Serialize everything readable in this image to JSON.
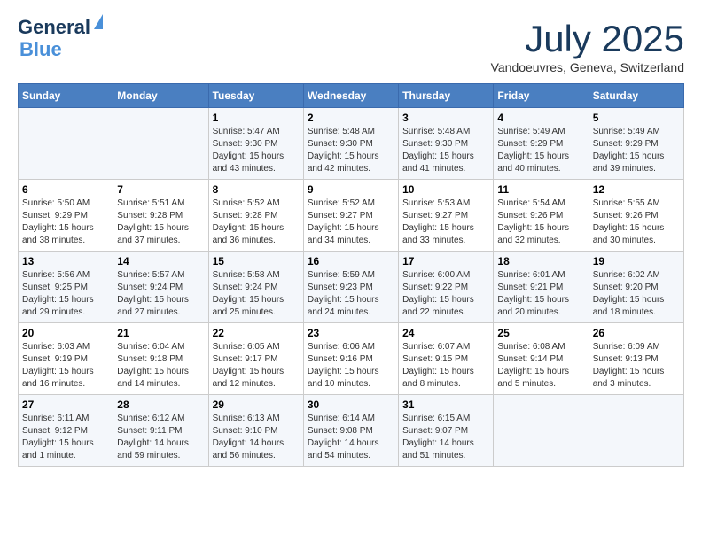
{
  "header": {
    "logo_line1": "General",
    "logo_line2": "Blue",
    "month": "July 2025",
    "location": "Vandoeuvres, Geneva, Switzerland"
  },
  "days_of_week": [
    "Sunday",
    "Monday",
    "Tuesday",
    "Wednesday",
    "Thursday",
    "Friday",
    "Saturday"
  ],
  "weeks": [
    [
      {
        "num": "",
        "info": ""
      },
      {
        "num": "",
        "info": ""
      },
      {
        "num": "1",
        "info": "Sunrise: 5:47 AM\nSunset: 9:30 PM\nDaylight: 15 hours\nand 43 minutes."
      },
      {
        "num": "2",
        "info": "Sunrise: 5:48 AM\nSunset: 9:30 PM\nDaylight: 15 hours\nand 42 minutes."
      },
      {
        "num": "3",
        "info": "Sunrise: 5:48 AM\nSunset: 9:30 PM\nDaylight: 15 hours\nand 41 minutes."
      },
      {
        "num": "4",
        "info": "Sunrise: 5:49 AM\nSunset: 9:29 PM\nDaylight: 15 hours\nand 40 minutes."
      },
      {
        "num": "5",
        "info": "Sunrise: 5:49 AM\nSunset: 9:29 PM\nDaylight: 15 hours\nand 39 minutes."
      }
    ],
    [
      {
        "num": "6",
        "info": "Sunrise: 5:50 AM\nSunset: 9:29 PM\nDaylight: 15 hours\nand 38 minutes."
      },
      {
        "num": "7",
        "info": "Sunrise: 5:51 AM\nSunset: 9:28 PM\nDaylight: 15 hours\nand 37 minutes."
      },
      {
        "num": "8",
        "info": "Sunrise: 5:52 AM\nSunset: 9:28 PM\nDaylight: 15 hours\nand 36 minutes."
      },
      {
        "num": "9",
        "info": "Sunrise: 5:52 AM\nSunset: 9:27 PM\nDaylight: 15 hours\nand 34 minutes."
      },
      {
        "num": "10",
        "info": "Sunrise: 5:53 AM\nSunset: 9:27 PM\nDaylight: 15 hours\nand 33 minutes."
      },
      {
        "num": "11",
        "info": "Sunrise: 5:54 AM\nSunset: 9:26 PM\nDaylight: 15 hours\nand 32 minutes."
      },
      {
        "num": "12",
        "info": "Sunrise: 5:55 AM\nSunset: 9:26 PM\nDaylight: 15 hours\nand 30 minutes."
      }
    ],
    [
      {
        "num": "13",
        "info": "Sunrise: 5:56 AM\nSunset: 9:25 PM\nDaylight: 15 hours\nand 29 minutes."
      },
      {
        "num": "14",
        "info": "Sunrise: 5:57 AM\nSunset: 9:24 PM\nDaylight: 15 hours\nand 27 minutes."
      },
      {
        "num": "15",
        "info": "Sunrise: 5:58 AM\nSunset: 9:24 PM\nDaylight: 15 hours\nand 25 minutes."
      },
      {
        "num": "16",
        "info": "Sunrise: 5:59 AM\nSunset: 9:23 PM\nDaylight: 15 hours\nand 24 minutes."
      },
      {
        "num": "17",
        "info": "Sunrise: 6:00 AM\nSunset: 9:22 PM\nDaylight: 15 hours\nand 22 minutes."
      },
      {
        "num": "18",
        "info": "Sunrise: 6:01 AM\nSunset: 9:21 PM\nDaylight: 15 hours\nand 20 minutes."
      },
      {
        "num": "19",
        "info": "Sunrise: 6:02 AM\nSunset: 9:20 PM\nDaylight: 15 hours\nand 18 minutes."
      }
    ],
    [
      {
        "num": "20",
        "info": "Sunrise: 6:03 AM\nSunset: 9:19 PM\nDaylight: 15 hours\nand 16 minutes."
      },
      {
        "num": "21",
        "info": "Sunrise: 6:04 AM\nSunset: 9:18 PM\nDaylight: 15 hours\nand 14 minutes."
      },
      {
        "num": "22",
        "info": "Sunrise: 6:05 AM\nSunset: 9:17 PM\nDaylight: 15 hours\nand 12 minutes."
      },
      {
        "num": "23",
        "info": "Sunrise: 6:06 AM\nSunset: 9:16 PM\nDaylight: 15 hours\nand 10 minutes."
      },
      {
        "num": "24",
        "info": "Sunrise: 6:07 AM\nSunset: 9:15 PM\nDaylight: 15 hours\nand 8 minutes."
      },
      {
        "num": "25",
        "info": "Sunrise: 6:08 AM\nSunset: 9:14 PM\nDaylight: 15 hours\nand 5 minutes."
      },
      {
        "num": "26",
        "info": "Sunrise: 6:09 AM\nSunset: 9:13 PM\nDaylight: 15 hours\nand 3 minutes."
      }
    ],
    [
      {
        "num": "27",
        "info": "Sunrise: 6:11 AM\nSunset: 9:12 PM\nDaylight: 15 hours\nand 1 minute."
      },
      {
        "num": "28",
        "info": "Sunrise: 6:12 AM\nSunset: 9:11 PM\nDaylight: 14 hours\nand 59 minutes."
      },
      {
        "num": "29",
        "info": "Sunrise: 6:13 AM\nSunset: 9:10 PM\nDaylight: 14 hours\nand 56 minutes."
      },
      {
        "num": "30",
        "info": "Sunrise: 6:14 AM\nSunset: 9:08 PM\nDaylight: 14 hours\nand 54 minutes."
      },
      {
        "num": "31",
        "info": "Sunrise: 6:15 AM\nSunset: 9:07 PM\nDaylight: 14 hours\nand 51 minutes."
      },
      {
        "num": "",
        "info": ""
      },
      {
        "num": "",
        "info": ""
      }
    ]
  ]
}
